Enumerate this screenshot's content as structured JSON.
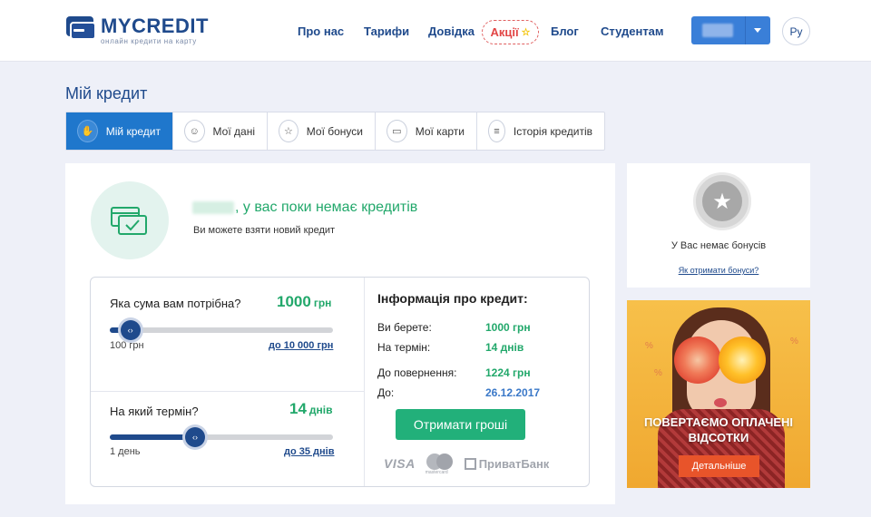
{
  "brand": {
    "name": "MYCREDIT",
    "tagline": "онлайн кредити на карту"
  },
  "nav": {
    "about": "Про нас",
    "tariffs": "Тарифи",
    "help": "Довідка",
    "promo": "Акції",
    "blog": "Блог",
    "students": "Студентам"
  },
  "header": {
    "lang": "Ру"
  },
  "page": {
    "title": "Мій кредит"
  },
  "tabs": [
    {
      "label": "Мій кредит",
      "icon": "hand-card-icon"
    },
    {
      "label": "Мої дані",
      "icon": "user-icon"
    },
    {
      "label": "Мої бонуси",
      "icon": "star-icon"
    },
    {
      "label": "Мої карти",
      "icon": "cards-icon"
    },
    {
      "label": "Історія кредитів",
      "icon": "list-icon"
    }
  ],
  "main": {
    "headline": ", у вас поки немає кредитів",
    "subline": "Ви можете взяти новий кредит"
  },
  "calculator": {
    "amount": {
      "question": "Яка сума вам потрібна?",
      "value": "1000",
      "unit": "грн",
      "min_label": "100 грн",
      "max_label": "до 10 000 грн",
      "fraction": 0.092
    },
    "term": {
      "question": "На який термін?",
      "value": "14",
      "unit": "днів",
      "min_label": "1 день",
      "max_label": "до 35 днів",
      "fraction": 0.382
    }
  },
  "info": {
    "title": "Інформація про кредит:",
    "take_label": "Ви берете:",
    "take_value": "1000 грн",
    "term_label": "На термін:",
    "term_value": "14 днів",
    "repay_label": "До повернення:",
    "repay_value": "1224 грн",
    "due_label": "До:",
    "due_value": "26.12.2017",
    "button": "Отримати гроші",
    "payments": {
      "visa": "VISA",
      "mastercard": "mastercard",
      "privat": "ПриватБанк"
    }
  },
  "bonus": {
    "text": "У Вас немає бонусів",
    "link": "Як отримати бонуси?"
  },
  "promo_banner": {
    "title_line1": "ПОВЕРТАЄМО ОПЛАЧЕНІ",
    "title_line2": "ВІДСОТКИ",
    "button": "Детальніше"
  },
  "colors": {
    "brand": "#1f4a8c",
    "accent_green": "#22a86b",
    "active_tab": "#1f77cc",
    "promo_red": "#e24545"
  }
}
